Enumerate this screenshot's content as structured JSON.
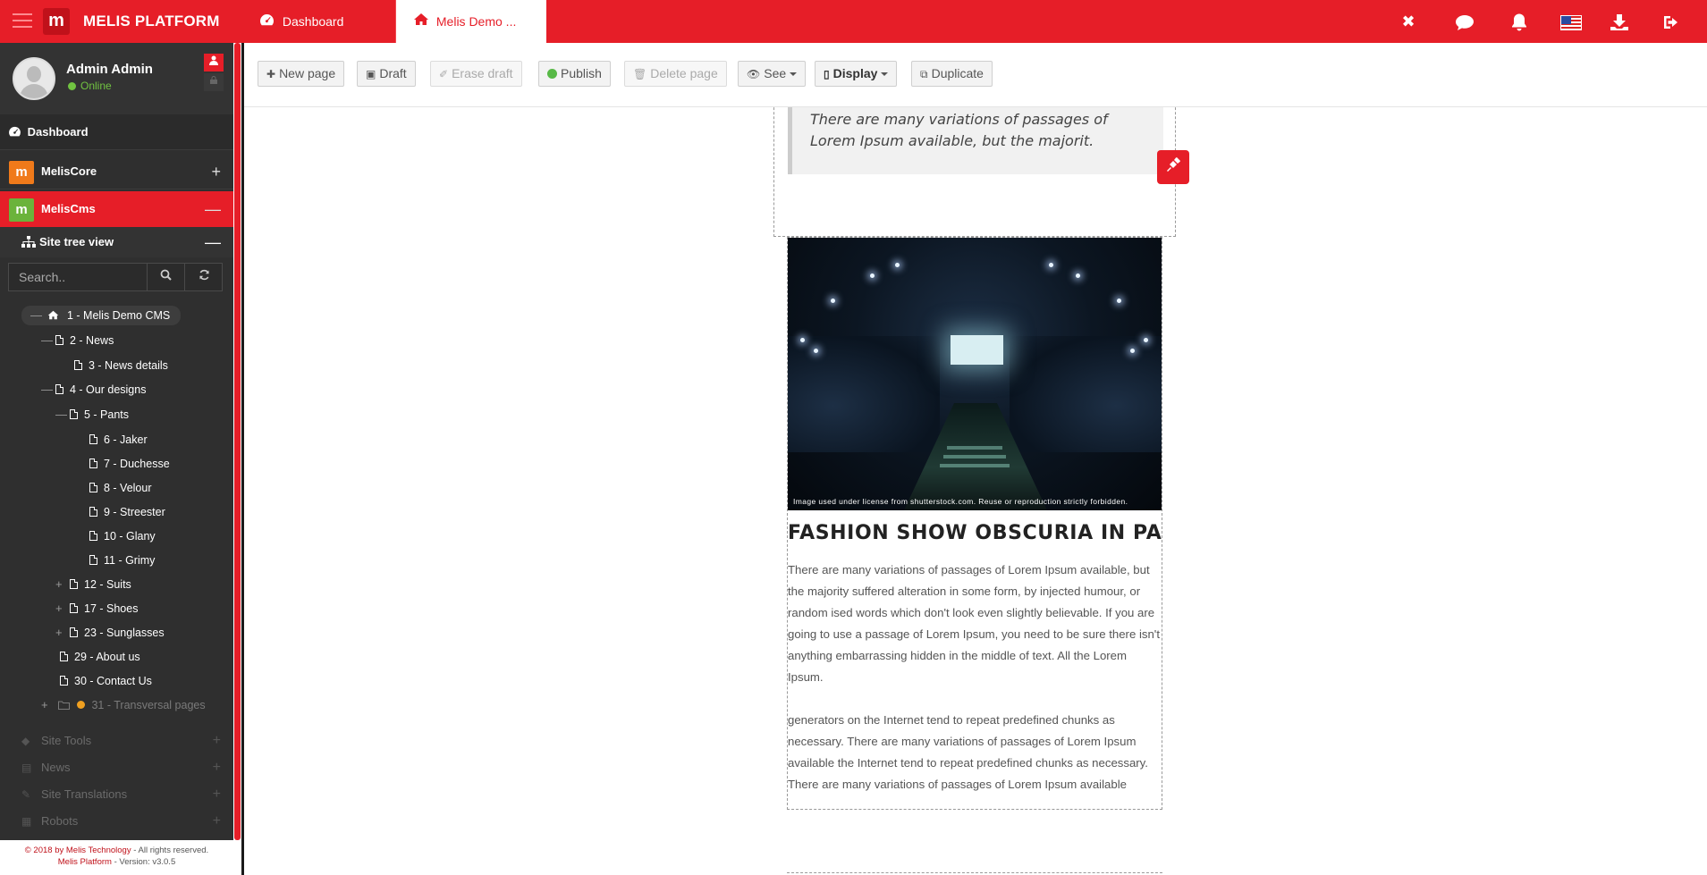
{
  "topbar": {
    "logo_letter": "m",
    "brand": "MELIS PLATFORM",
    "tabs": [
      {
        "label": "Dashboard",
        "icon": "dashboard-icon"
      },
      {
        "label": "Melis Demo ...",
        "icon": "home-icon"
      }
    ],
    "right_icons": [
      "close-icon",
      "chat-icon",
      "bell-icon",
      "us-flag-icon",
      "download-icon",
      "logout-icon"
    ],
    "close_glyph": "✖",
    "accent": "#e61e28"
  },
  "user": {
    "name": "Admin Admin",
    "status": "Online"
  },
  "nav": {
    "dashboard": "Dashboard",
    "core": {
      "label": "MelisCore",
      "toggle": "+"
    },
    "cms": {
      "label": "MelisCms",
      "toggle": "—"
    },
    "site_tree": {
      "label": "Site tree view",
      "toggle": "—"
    }
  },
  "search": {
    "placeholder": "Search.."
  },
  "tree": [
    {
      "label": "1 - Melis Demo CMS",
      "toggle": "—"
    },
    {
      "label": "2 - News",
      "toggle": "—"
    },
    {
      "label": "3 - News details",
      "toggle": ""
    },
    {
      "label": "4 - Our designs",
      "toggle": "—"
    },
    {
      "label": "5 - Pants",
      "toggle": "—"
    },
    {
      "label": "6 - Jaker",
      "toggle": ""
    },
    {
      "label": "7 - Duchesse",
      "toggle": ""
    },
    {
      "label": "8 - Velour",
      "toggle": ""
    },
    {
      "label": "9 - Streester",
      "toggle": ""
    },
    {
      "label": "10 - Glany",
      "toggle": ""
    },
    {
      "label": "11 - Grimy",
      "toggle": ""
    },
    {
      "label": "12 - Suits",
      "toggle": "+"
    },
    {
      "label": "17 - Shoes",
      "toggle": "+"
    },
    {
      "label": "23 - Sunglasses",
      "toggle": "+"
    },
    {
      "label": "29 - About us",
      "toggle": ""
    },
    {
      "label": "30 - Contact Us",
      "toggle": ""
    },
    {
      "label": "31 - Transversal pages",
      "toggle": "+"
    }
  ],
  "tools": [
    {
      "label": "Site Tools",
      "toggle": "+"
    },
    {
      "label": "News",
      "toggle": "+"
    },
    {
      "label": "Site Translations",
      "toggle": "+"
    },
    {
      "label": "Robots",
      "toggle": "+"
    }
  ],
  "footer": {
    "line1_prefix": "© 2018 by Melis Technology",
    "line1_suffix": " - All rights reserved.",
    "line2_prefix": "Melis Platform",
    "line2_suffix": " - Version: v3.0.5"
  },
  "toolbar": {
    "new_page": "New page",
    "draft": "Draft",
    "erase_draft": "Erase draft",
    "publish": "Publish",
    "delete_page": "Delete page",
    "see": "See",
    "display": "Display",
    "duplicate": "Duplicate"
  },
  "content": {
    "quote": "There are many variations of passages of Lorem Ipsum available, but the majorit.",
    "image_caption": "Image used under license from shutterstock.com. Reuse or reproduction strictly forbidden.",
    "title": "FASHION SHOW OBSCURIA IN PA...",
    "paragraph1": "There are many variations of passages of Lorem Ipsum available, but the majority suffered alteration in some form, by injected humour, or random ised words which don't look even slightly believable. If you are going to use a passage of Lorem Ipsum, you need to be sure there isn't anything embarrassing hidden in the middle of text. All the Lorem Ipsum.",
    "paragraph2": "generators on the Internet tend to repeat predefined chunks as necessary. There are many variations of passages of Lorem Ipsum available the Internet tend to repeat predefined chunks as necessary. There are many variations of passages of Lorem Ipsum available"
  }
}
